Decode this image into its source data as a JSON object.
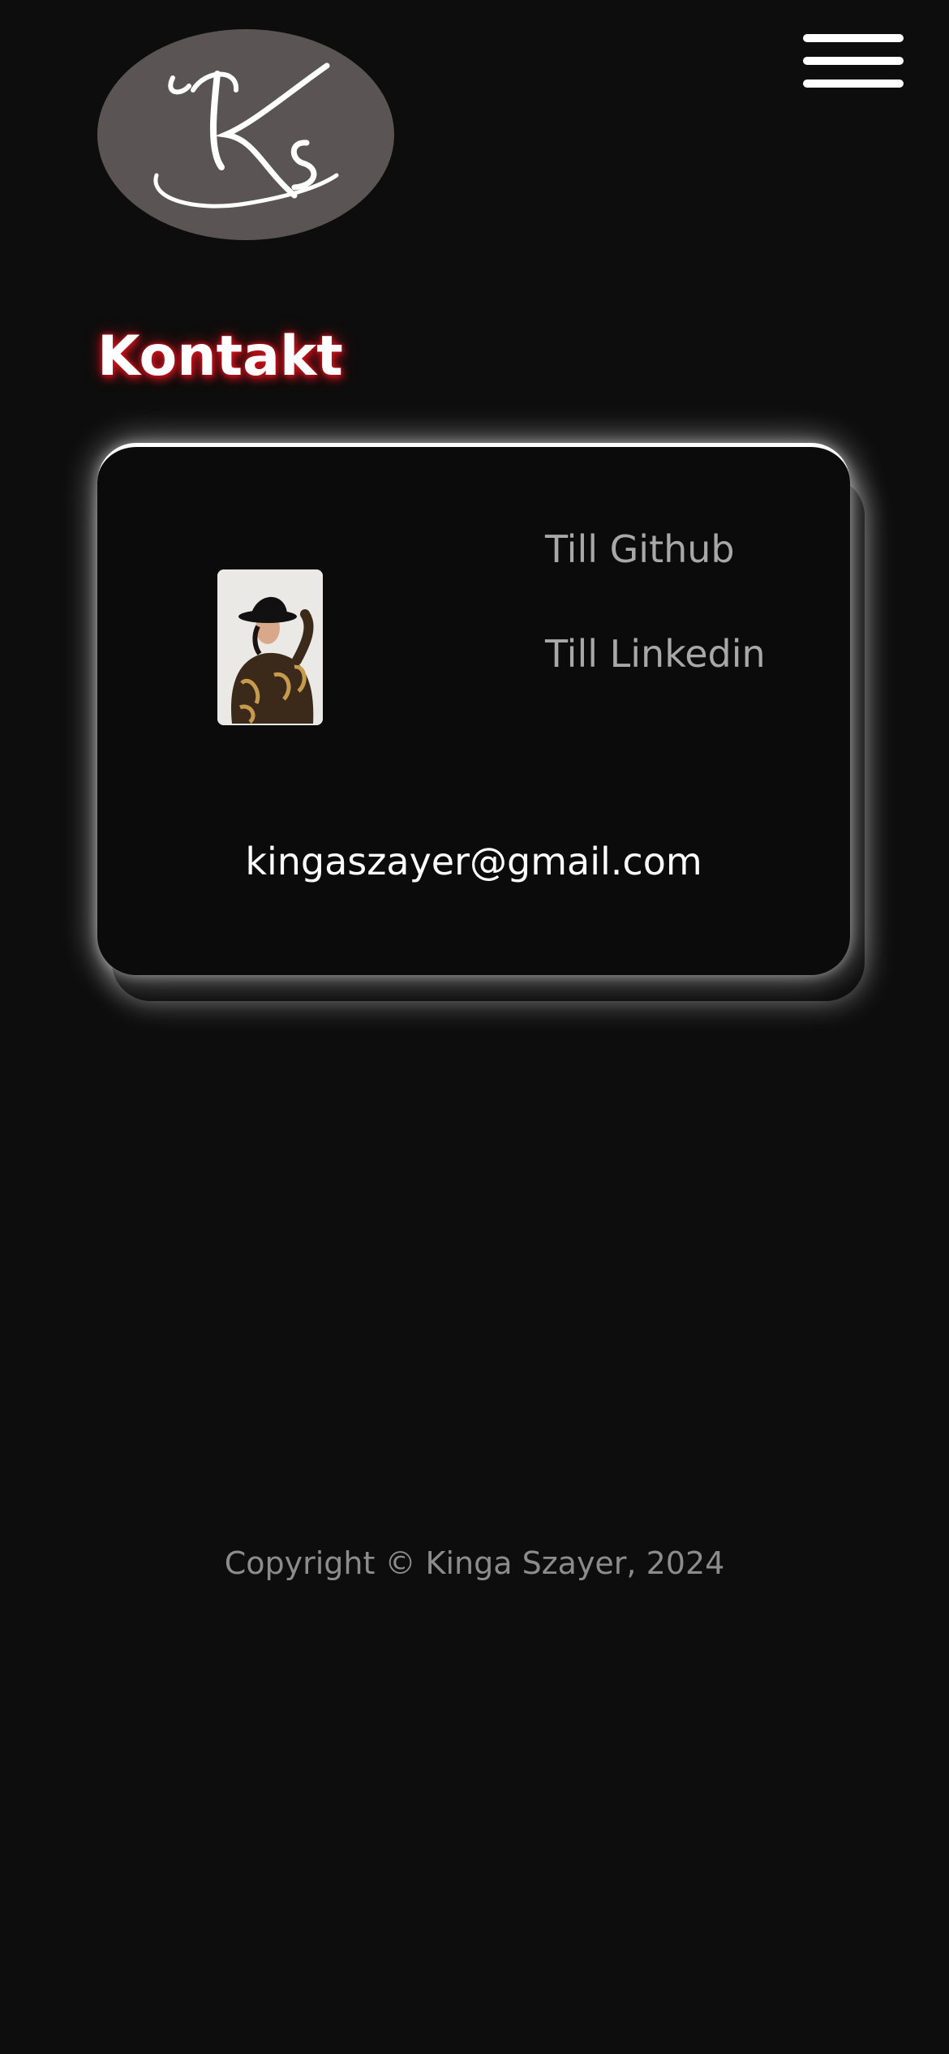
{
  "header": {
    "logo_text": "Ks",
    "menu_icon": "hamburger-menu-icon"
  },
  "page": {
    "title": "Kontakt"
  },
  "contact_card": {
    "photo": "profile-photo",
    "github_label": "Till Github",
    "linkedin_label": "Till Linkedin",
    "email": "kingaszayer@gmail.com"
  },
  "footer": {
    "copyright": "Copyright © Kinga Szayer, 2024"
  },
  "colors": {
    "background": "#0d0d0d",
    "logo_background": "#5a5554",
    "title_glow": "#d0141c",
    "link_text": "#a8a8a8",
    "footer_text": "#8c8c8c"
  }
}
